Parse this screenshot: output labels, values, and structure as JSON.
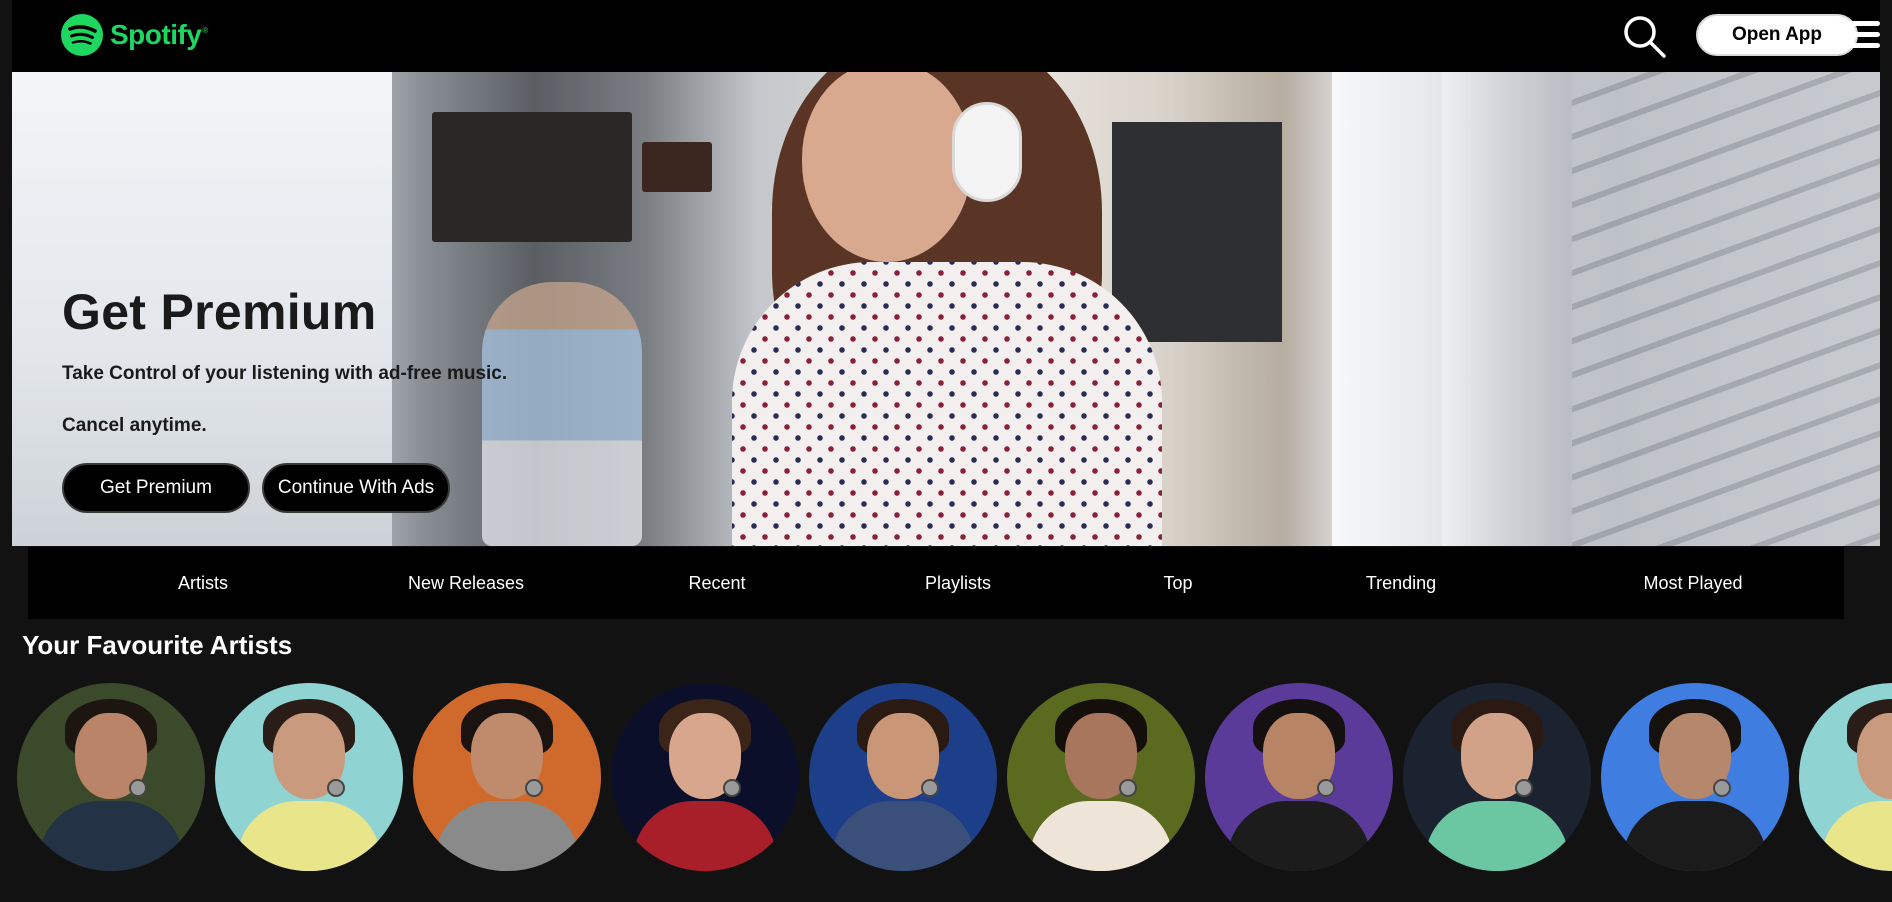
{
  "brand": {
    "name": "Spotify",
    "trademark": "®",
    "color": "#1ed760"
  },
  "navbar": {
    "search_icon": "search-icon",
    "open_app_label": "Open App",
    "menu_icon": "hamburger-menu-icon"
  },
  "hero": {
    "title": "Get Premium",
    "subtitle": "Take Control of your listening with ad-free music.",
    "note": "Cancel anytime.",
    "primary_button": "Get Premium",
    "secondary_button": "Continue With Ads"
  },
  "tabs": [
    {
      "label": "Artists"
    },
    {
      "label": "New Releases"
    },
    {
      "label": "Recent"
    },
    {
      "label": "Playlists"
    },
    {
      "label": "Top"
    },
    {
      "label": "Trending"
    },
    {
      "label": "Most Played"
    }
  ],
  "favourites": {
    "title": "Your Favourite Artists",
    "artists": [
      {
        "bg": "#3b4a2a",
        "skin": "#b98468",
        "hair": "#1c1510",
        "outfit": "#233244"
      },
      {
        "bg": "#8fd3d2",
        "skin": "#c99a7e",
        "hair": "#2a1c16",
        "outfit": "#e8e58a"
      },
      {
        "bg": "#d06a2c",
        "skin": "#c08a6c",
        "hair": "#1a1310",
        "outfit": "#8a8a8a"
      },
      {
        "bg": "#0c0f2a",
        "skin": "#d7a68c",
        "hair": "#3b2418",
        "outfit": "#a81f2a"
      },
      {
        "bg": "#1d3f8a",
        "skin": "#c99777",
        "hair": "#2a1a12",
        "outfit": "#3a4f7a"
      },
      {
        "bg": "#5a6a1e",
        "skin": "#a7765c",
        "hair": "#150f0c",
        "outfit": "#efe4d8"
      },
      {
        "bg": "#5b3b9a",
        "skin": "#b88466",
        "hair": "#141010",
        "outfit": "#1c1c1c"
      },
      {
        "bg": "#1b2230",
        "skin": "#d2a288",
        "hair": "#2b1a14",
        "outfit": "#6ac7a2"
      },
      {
        "bg": "#3f7de0",
        "skin": "#b5876c",
        "hair": "#15110f",
        "outfit": "#1b1b1b"
      },
      {
        "bg": "#8fd3d2",
        "skin": "#c99a7e",
        "hair": "#2a1c16",
        "outfit": "#e8e58a"
      }
    ]
  }
}
